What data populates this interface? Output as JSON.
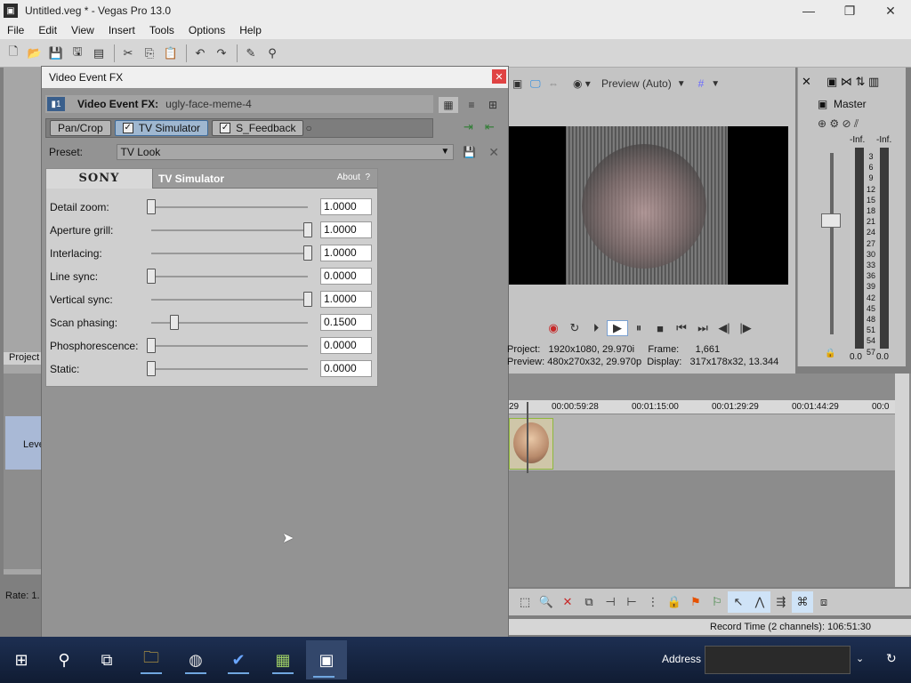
{
  "window": {
    "title": "Untitled.veg * - Vegas Pro 13.0",
    "app_icon": "vegas-icon"
  },
  "menu": [
    "File",
    "Edit",
    "View",
    "Insert",
    "Tools",
    "Options",
    "Help"
  ],
  "left_panel": {
    "tab_label": "Project",
    "rate_label": "Rate: 1.",
    "track_label": "Leve"
  },
  "fx_dialog": {
    "title": "Video Event FX",
    "event_label": "Video Event FX:",
    "event_name": "ugly-face-meme-4",
    "chain": [
      "Pan/Crop",
      "TV Simulator",
      "S_Feedback"
    ],
    "selected_index": 1,
    "preset_label": "Preset:",
    "preset_value": "TV Look",
    "plugin_brand": "SONY",
    "plugin_name": "TV Simulator",
    "about_label": "About",
    "help_label": "?",
    "params": [
      {
        "label": "Detail zoom:",
        "value": "1.0000",
        "level": 0.0
      },
      {
        "label": "Aperture grill:",
        "value": "1.0000",
        "level": 1.0
      },
      {
        "label": "Interlacing:",
        "value": "1.0000",
        "level": 1.0
      },
      {
        "label": "Line sync:",
        "value": "0.0000",
        "level": 0.0
      },
      {
        "label": "Vertical sync:",
        "value": "1.0000",
        "level": 1.0
      },
      {
        "label": "Scan phasing:",
        "value": "0.1500",
        "level": 0.15
      },
      {
        "label": "Phosphorescence:",
        "value": "0.0000",
        "level": 0.0
      },
      {
        "label": "Static:",
        "value": "0.0000",
        "level": 0.0
      }
    ]
  },
  "preview": {
    "mode_label": "Preview (Auto)",
    "project_label": "Project:",
    "project_value": "1920x1080, 29.970i",
    "preview_label": "Preview:",
    "preview_value": "480x270x32, 29.970p",
    "frame_label": "Frame:",
    "frame_value": "1,661",
    "display_label": "Display:",
    "display_value": "317x178x32, 13.344"
  },
  "master": {
    "title": "Master",
    "peak_left": "-Inf.",
    "peak_right": "-Inf.",
    "scale": [
      "3",
      "6",
      "9",
      "12",
      "15",
      "18",
      "21",
      "24",
      "27",
      "30",
      "33",
      "36",
      "39",
      "42",
      "45",
      "48",
      "51",
      "54",
      "57"
    ],
    "level_left": "0.0",
    "level_right": "0.0"
  },
  "timeline": {
    "ruler": [
      "29",
      "00:00:59:28",
      "00:01:15:00",
      "00:01:29:29",
      "00:01:44:29",
      "00:0"
    ]
  },
  "status": {
    "record_time": "Record Time (2 channels): 106:51:30"
  },
  "taskbar": {
    "address_label": "Address",
    "apps": [
      "windows-start-icon",
      "search-icon",
      "task-view-icon",
      "file-explorer-icon",
      "chrome-icon",
      "app-icon",
      "app2-icon",
      "vegas-icon"
    ]
  }
}
